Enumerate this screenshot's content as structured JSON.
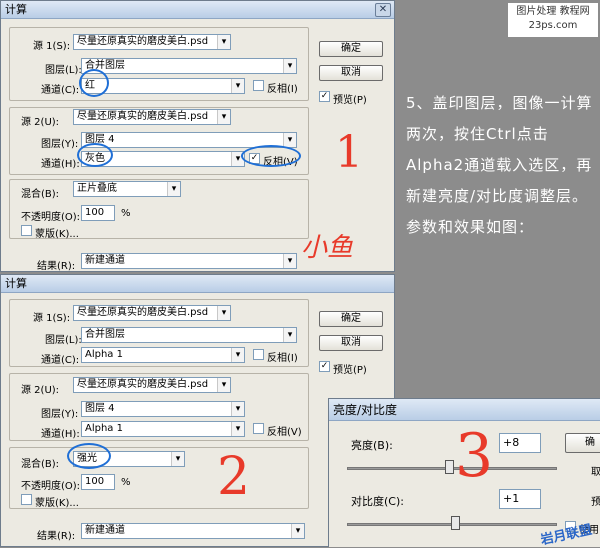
{
  "top_dialog": {
    "title": "计算",
    "source1": {
      "label": "源 1(S):",
      "file": "尽量还原真实的磨皮美白.psd",
      "layer_label": "图层(L):",
      "layer": "合并图层",
      "channel_label": "通道(C):",
      "channel": "红",
      "invert_label": "反相(I)",
      "invert_checked": false
    },
    "source2": {
      "label": "源 2(U):",
      "file": "尽量还原真实的磨皮美白.psd",
      "layer_label": "图层(Y):",
      "layer": "图层 4",
      "channel_label": "通道(H):",
      "channel": "灰色",
      "invert_label": "反相(V)",
      "invert_checked": true
    },
    "blend": {
      "label": "混合(B):",
      "mode": "正片叠底",
      "opacity_label": "不透明度(O):",
      "opacity": "100",
      "unit": "%",
      "mask_label": "蒙版(K)..."
    },
    "result_label": "结果(R):",
    "result": "新建通道",
    "ok": "确定",
    "cancel": "取消",
    "preview_label": "预览(P)",
    "preview_checked": true
  },
  "bottom_dialog": {
    "title": "计算",
    "source1": {
      "label": "源 1(S):",
      "file": "尽量还原真实的磨皮美白.psd",
      "layer_label": "图层(L):",
      "layer": "合并图层",
      "channel_label": "通道(C):",
      "channel": "Alpha 1",
      "invert_label": "反相(I)",
      "invert_checked": false
    },
    "source2": {
      "label": "源 2(U):",
      "file": "尽量还原真实的磨皮美白.psd",
      "layer_label": "图层(Y):",
      "layer": "图层 4",
      "channel_label": "通道(H):",
      "channel": "Alpha 1",
      "invert_label": "反相(V)",
      "invert_checked": false
    },
    "blend": {
      "label": "混合(B):",
      "mode": "强光",
      "opacity_label": "不透明度(O):",
      "opacity": "100",
      "unit": "%",
      "mask_label": "蒙版(K)..."
    },
    "result_label": "结果(R):",
    "result": "新建通道",
    "ok": "确定",
    "cancel": "取消",
    "preview_label": "预览(P)",
    "preview_checked": true
  },
  "bc_dialog": {
    "title": "亮度/对比度",
    "brightness_label": "亮度(B):",
    "brightness": "+8",
    "contrast_label": "对比度(C):",
    "contrast": "+1",
    "ok_partial": "确",
    "reset_partial": "取",
    "preview_partial": "预",
    "legacy_partial": "使用"
  },
  "annotations": {
    "one": "1",
    "two": "2",
    "three": "3",
    "signature": "小鱼"
  },
  "colors": {
    "annotation_blue": "#1f6fd6",
    "annotation_red": "#e83a2a"
  },
  "tutorial_text": "5、盖印图层，图像一计算两次，按住Ctrl点击Alpha2通道载入选区，再新建亮度/对比度调整层。参数和效果如图：",
  "watermark_top": "图片处理 教程网 23ps.com",
  "watermark_bottom": "岩月联盟"
}
